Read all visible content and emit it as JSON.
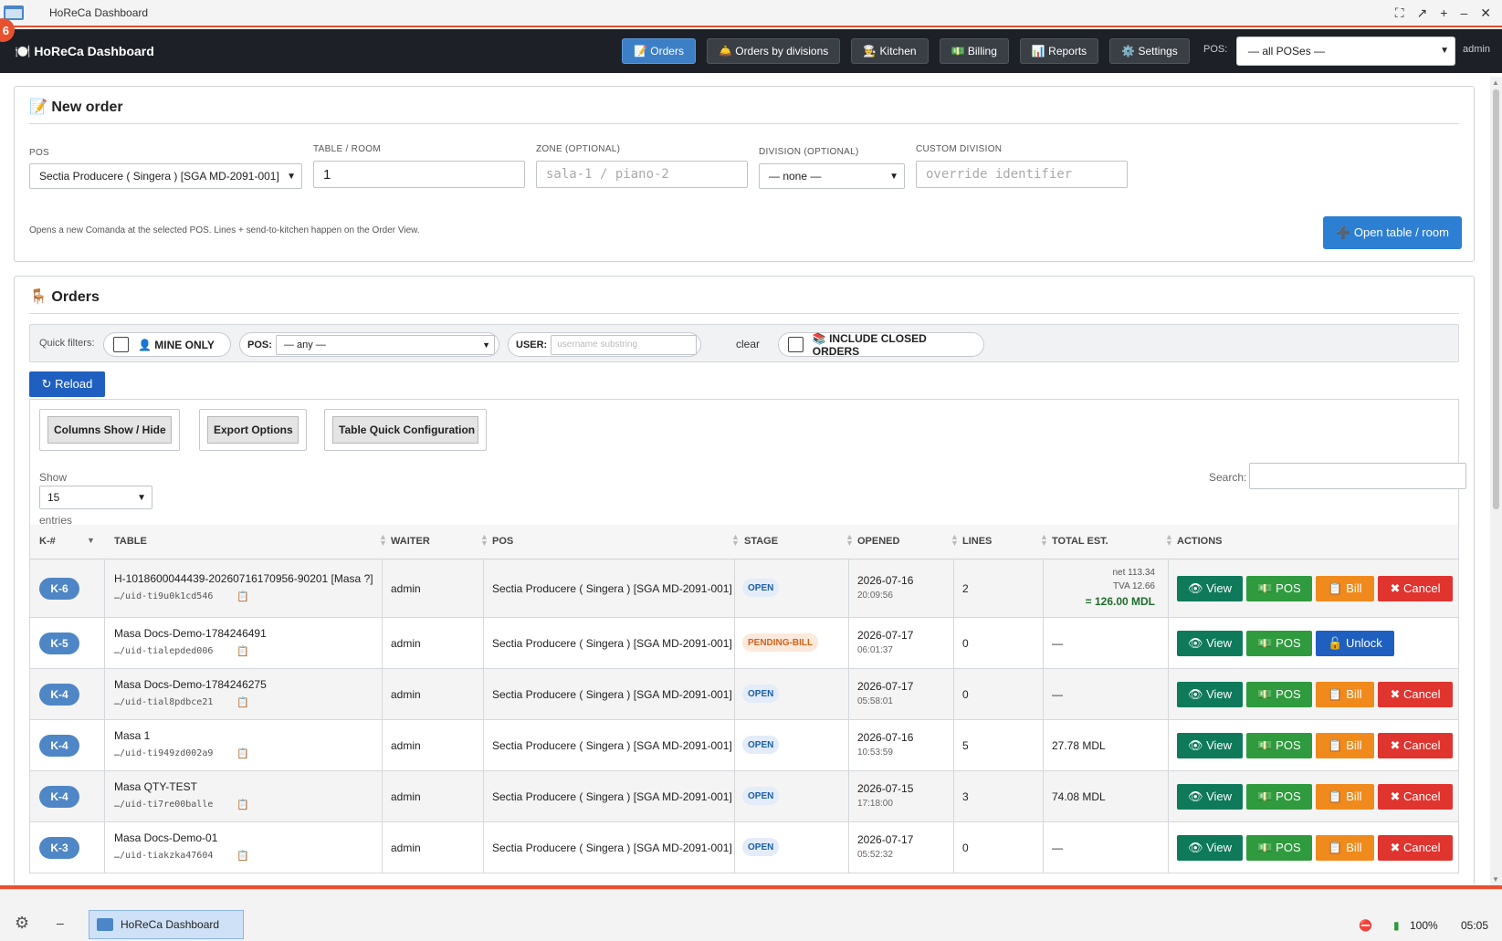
{
  "window": {
    "title": "HoReCa Dashboard",
    "corner_badge": "6"
  },
  "navbar": {
    "brand": "🍽️ HoReCa Dashboard",
    "buttons": [
      {
        "label": "📝 Orders",
        "active": true
      },
      {
        "label": "🛎️ Orders by divisions"
      },
      {
        "label": "👨‍🍳 Kitchen"
      },
      {
        "label": "💵 Billing"
      },
      {
        "label": "📊 Reports"
      },
      {
        "label": "⚙️ Settings"
      }
    ],
    "pos_label": "POS:",
    "pos_value": "— all POSes —",
    "user": "admin"
  },
  "new_order": {
    "title": "📝 New order",
    "pos_label": "POS",
    "pos_value": "Sectia Producere ( Singera ) [SGA MD-2091-001]",
    "table_label": "TABLE / ROOM",
    "table_value": "1",
    "zone_label": "ZONE (OPTIONAL)",
    "zone_placeholder": "sala-1 / piano-2",
    "division_label": "DIVISION (OPTIONAL)",
    "division_value": "— none —",
    "custom_label": "CUSTOM DIVISION",
    "custom_placeholder": "override identifier",
    "hint": "Opens a new Comanda at the selected POS. Lines + send-to-kitchen happen on the Order View.",
    "open_button": "➕ Open table / room"
  },
  "orders": {
    "title": "🪑 Orders",
    "filters": {
      "label": "Quick filters:",
      "mine_only": "👤 MINE ONLY",
      "pos_label": "POS:",
      "pos_value": "— any —",
      "user_label": "USER:",
      "user_placeholder": "username substring",
      "clear": "clear",
      "include_closed": "📚 INCLUDE CLOSED ORDERS"
    },
    "reload": "↻ Reload",
    "tools": {
      "columns": "Columns Show / Hide",
      "export": "Export Options",
      "quick_config": "Table Quick Configuration"
    },
    "show_label": "Show",
    "show_value": "15",
    "entries_label": "entries",
    "search_label": "Search:",
    "columns": [
      "K-#",
      "TABLE",
      "WAITER",
      "POS",
      "STAGE",
      "OPENED",
      "LINES",
      "TOTAL EST.",
      "ACTIONS"
    ],
    "rows": [
      {
        "k": "K-6",
        "table": "H-1018600044439-20260716170956-90201 [Masa ?]",
        "uid": "…/uid-ti9u0k1cd546",
        "waiter": "admin",
        "pos": "Sectia Producere ( Singera ) [SGA MD-2091-001]",
        "stage": "OPEN",
        "date": "2026-07-16",
        "time": "20:09:56",
        "lines": "2",
        "net": "net 113.34",
        "tva": "TVA 12.66",
        "total": "= 126.00 MDL",
        "a3": "📋 Bill",
        "a4": "✖ Cancel"
      },
      {
        "k": "K-5",
        "table": "Masa Docs-Demo-1784246491",
        "uid": "…/uid-tialepded006",
        "waiter": "admin",
        "pos": "Sectia Producere ( Singera ) [SGA MD-2091-001]",
        "stage": "PENDING-BILL",
        "date": "2026-07-17",
        "time": "06:01:37",
        "lines": "0",
        "total": "—",
        "a3": "🔓 Unlock"
      },
      {
        "k": "K-4",
        "table": "Masa Docs-Demo-1784246275",
        "uid": "…/uid-tial8pdbce21",
        "waiter": "admin",
        "pos": "Sectia Producere ( Singera ) [SGA MD-2091-001]",
        "stage": "OPEN",
        "date": "2026-07-17",
        "time": "05:58:01",
        "lines": "0",
        "total": "—",
        "a3": "📋 Bill",
        "a4": "✖ Cancel"
      },
      {
        "k": "K-4",
        "table": "Masa 1",
        "uid": "…/uid-ti949zd002a9",
        "waiter": "admin",
        "pos": "Sectia Producere ( Singera ) [SGA MD-2091-001]",
        "stage": "OPEN",
        "date": "2026-07-16",
        "time": "10:53:59",
        "lines": "5",
        "total": "27.78 MDL",
        "a3": "📋 Bill",
        "a4": "✖ Cancel"
      },
      {
        "k": "K-4",
        "table": "Masa QTY-TEST",
        "uid": "…/uid-ti7re00balle",
        "waiter": "admin",
        "pos": "Sectia Producere ( Singera ) [SGA MD-2091-001]",
        "stage": "OPEN",
        "date": "2026-07-15",
        "time": "17:18:00",
        "lines": "3",
        "total": "74.08 MDL",
        "a3": "📋 Bill",
        "a4": "✖ Cancel"
      },
      {
        "k": "K-3",
        "table": "Masa Docs-Demo-01",
        "uid": "…/uid-tiakzka47604",
        "waiter": "admin",
        "pos": "Sectia Producere ( Singera ) [SGA MD-2091-001]",
        "stage": "OPEN",
        "date": "2026-07-17",
        "time": "05:52:32",
        "lines": "0",
        "total": "—",
        "a3": "📋 Bill",
        "a4": "✖ Cancel"
      }
    ],
    "action_view": "👁 View",
    "action_pos": "💵 POS"
  },
  "taskbar": {
    "task": "HoReCa Dashboard",
    "battery": "100%",
    "clock": "05:05"
  }
}
